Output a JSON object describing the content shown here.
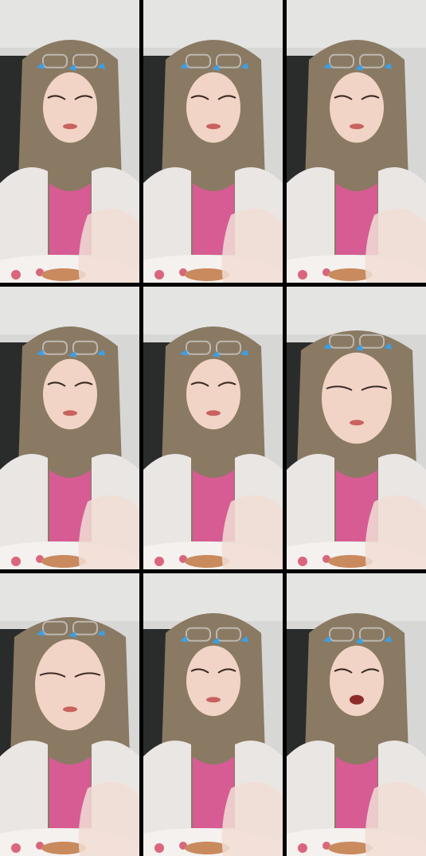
{
  "grid": {
    "rows": 3,
    "cols": 3,
    "frames": [
      {
        "id": "frame-1",
        "pose": "head-tilt-hand-gloved-right"
      },
      {
        "id": "frame-2",
        "pose": "eyes-closed-holding-food"
      },
      {
        "id": "frame-3",
        "pose": "looking-down-gloved-hand"
      },
      {
        "id": "frame-4",
        "pose": "looking-down-gloved-hand"
      },
      {
        "id": "frame-5",
        "pose": "hand-raised-eating"
      },
      {
        "id": "frame-6",
        "pose": "close-up-holding-food"
      },
      {
        "id": "frame-7",
        "pose": "close-up-eyes-half-closed"
      },
      {
        "id": "frame-8",
        "pose": "looking-down-hand-near-chest"
      },
      {
        "id": "frame-9",
        "pose": "mouth-open-surprised"
      }
    ]
  },
  "colors": {
    "wall": "#d7d7d5",
    "door": "#2a2c2c",
    "hair": "#8a7a63",
    "hair_tips": "#4e6a4c",
    "skin": "#f1d4c6",
    "top": "#d65c93",
    "cardigan": "#e9e6e4",
    "plate": "#f4f1ee",
    "food": "#c98a5e",
    "sticker": "#3aa0e6"
  }
}
